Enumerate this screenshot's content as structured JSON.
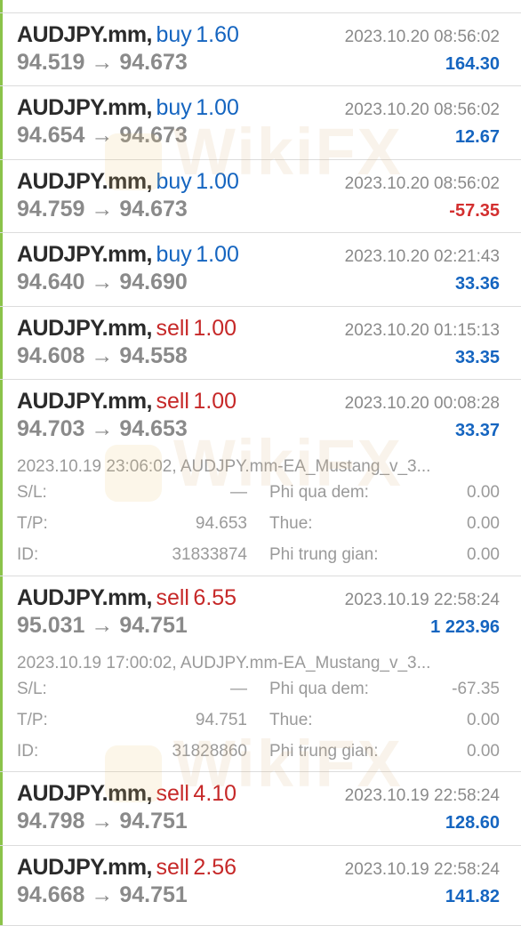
{
  "trades": [
    {
      "symbol": "AUDJPY.mm,",
      "side": "buy",
      "volume": "1.60",
      "time": "2023.10.20 08:56:02",
      "prices": "94.519 → 94.673",
      "profit": "164.30"
    },
    {
      "symbol": "AUDJPY.mm,",
      "side": "buy",
      "volume": "1.00",
      "time": "2023.10.20 08:56:02",
      "prices": "94.654 → 94.673",
      "profit": "12.67"
    },
    {
      "symbol": "AUDJPY.mm,",
      "side": "buy",
      "volume": "1.00",
      "time": "2023.10.20 08:56:02",
      "prices": "94.759 → 94.673",
      "profit": "-57.35"
    },
    {
      "symbol": "AUDJPY.mm,",
      "side": "buy",
      "volume": "1.00",
      "time": "2023.10.20 02:21:43",
      "prices": "94.640 → 94.690",
      "profit": "33.36"
    },
    {
      "symbol": "AUDJPY.mm,",
      "side": "sell",
      "volume": "1.00",
      "time": "2023.10.20 01:15:13",
      "prices": "94.608 → 94.558",
      "profit": "33.35"
    },
    {
      "symbol": "AUDJPY.mm,",
      "side": "sell",
      "volume": "1.00",
      "time": "2023.10.20 00:08:28",
      "prices": "94.703 → 94.653",
      "profit": "33.37",
      "details": {
        "opened": "2023.10.19 23:06:02, AUDJPY.mm-EA_Mustang_v_3...",
        "sl_label": "S/L:",
        "sl": "—",
        "tp_label": "T/P:",
        "tp": "94.653",
        "id_label": "ID:",
        "id": "31833874",
        "swap_label": "Phi qua dem:",
        "swap": "0.00",
        "tax_label": "Thue:",
        "tax": "0.00",
        "fee_label": "Phi trung gian:",
        "fee": "0.00"
      }
    },
    {
      "symbol": "AUDJPY.mm,",
      "side": "sell",
      "volume": "6.55",
      "time": "2023.10.19 22:58:24",
      "prices": "95.031 → 94.751",
      "profit": "1 223.96",
      "details": {
        "opened": "2023.10.19 17:00:02, AUDJPY.mm-EA_Mustang_v_3...",
        "sl_label": "S/L:",
        "sl": "—",
        "tp_label": "T/P:",
        "tp": "94.751",
        "id_label": "ID:",
        "id": "31828860",
        "swap_label": "Phi qua dem:",
        "swap": "-67.35",
        "tax_label": "Thue:",
        "tax": "0.00",
        "fee_label": "Phi trung gian:",
        "fee": "0.00"
      }
    },
    {
      "symbol": "AUDJPY.mm,",
      "side": "sell",
      "volume": "4.10",
      "time": "2023.10.19 22:58:24",
      "prices": "94.798 → 94.751",
      "profit": "128.60"
    },
    {
      "symbol": "AUDJPY.mm,",
      "side": "sell",
      "volume": "2.56",
      "time": "2023.10.19 22:58:24",
      "prices": "94.668 → 94.751",
      "profit": "141.82"
    }
  ],
  "watermark": "WikiFX",
  "colors": {
    "buy": "#1565c0",
    "sell": "#c62828",
    "profit_positive": "#1565c0",
    "profit_negative": "#d32f2f",
    "accent_bar": "#8bc34a"
  }
}
